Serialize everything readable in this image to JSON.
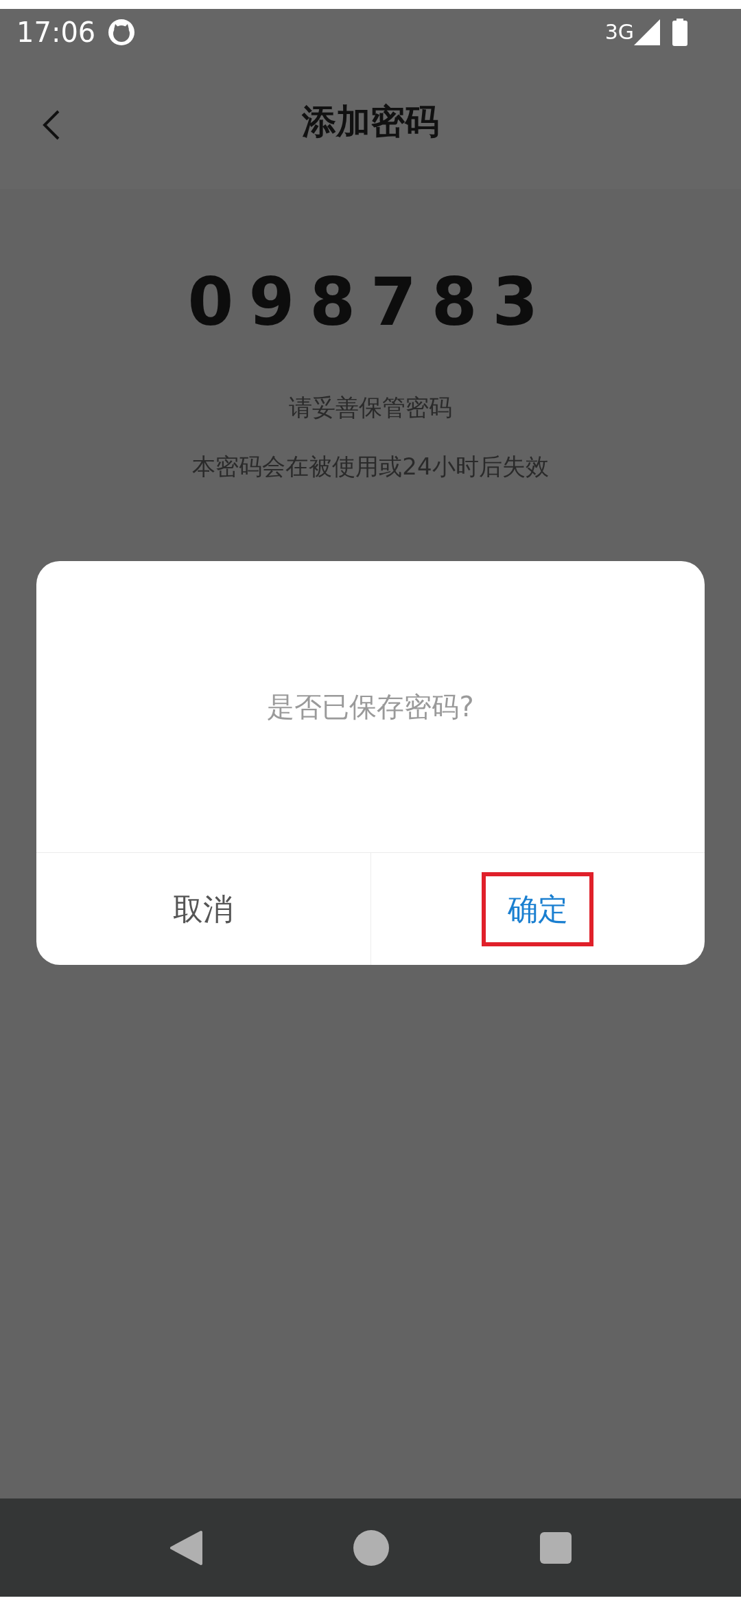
{
  "status_bar": {
    "time": "17:06",
    "network": "3G"
  },
  "header": {
    "title": "添加密码"
  },
  "code": "098783",
  "notes": [
    "请妥善保管密码",
    "本密码会在被使用或24小时后失效"
  ],
  "dialog": {
    "message": "是否已保存密码?",
    "buttons": [
      {
        "label": "取消",
        "kind": "cancel",
        "highlighted": false
      },
      {
        "label": "确定",
        "kind": "confirm",
        "highlighted": true
      }
    ]
  }
}
